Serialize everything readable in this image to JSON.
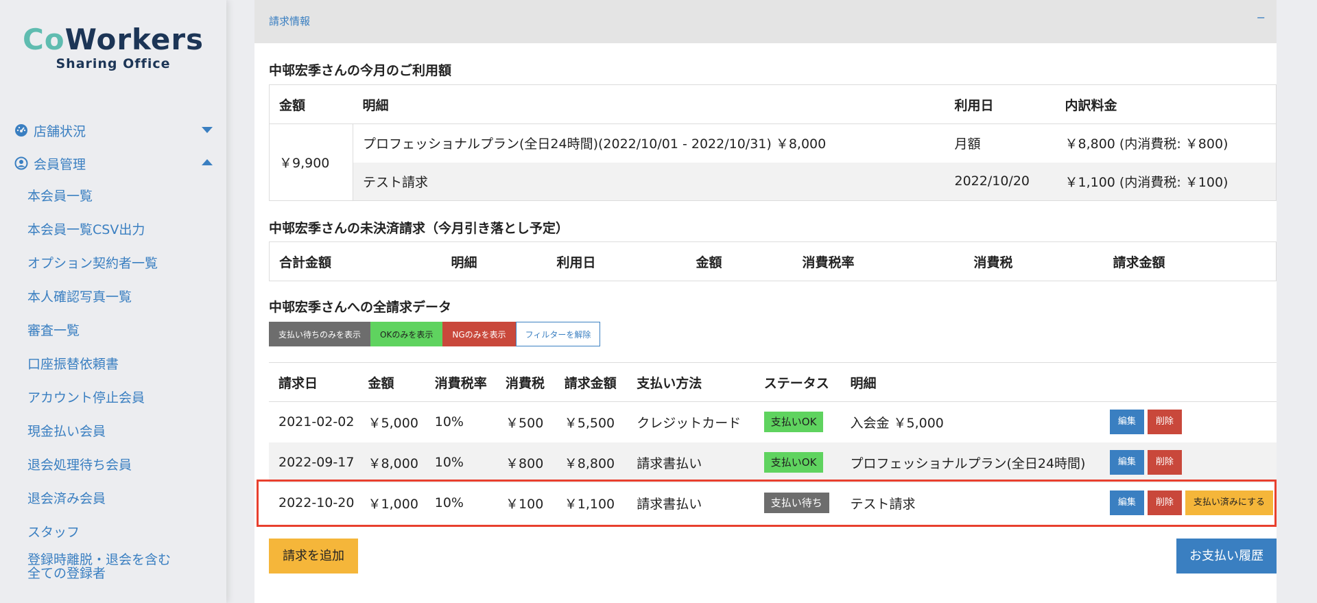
{
  "brand": {
    "logo_co": "Co",
    "logo_workers": "Workers",
    "logo_sub": "Sharing Office",
    "colors": {
      "primary": "#3a7fc1",
      "teal": "#5fbcb0",
      "navy": "#1c3556"
    }
  },
  "sidebar": {
    "groups": [
      {
        "label": "店舗状況",
        "icon": "dashboard-icon",
        "state": "collapsed"
      },
      {
        "label": "会員管理",
        "icon": "user-circle-icon",
        "state": "expanded"
      }
    ],
    "items": [
      {
        "label": "本会員一覧"
      },
      {
        "label": "本会員一覧CSV出力"
      },
      {
        "label": "オプション契約者一覧"
      },
      {
        "label": "本人確認写真一覧"
      },
      {
        "label": "審査一覧"
      },
      {
        "label": "口座振替依頼書"
      },
      {
        "label": "アカウント停止会員"
      },
      {
        "label": "現金払い会員"
      },
      {
        "label": "退会処理待ち会員"
      },
      {
        "label": "退会済み会員"
      },
      {
        "label": "スタッフ"
      },
      {
        "label_line1": "登録時離脱・退会を含む",
        "label_line2": "全ての登録者"
      }
    ]
  },
  "panel": {
    "title": "請求情報",
    "collapse_label": "−"
  },
  "usage": {
    "title": "中邨宏季さんの今月のご利用額",
    "headers": [
      "金額",
      "明細",
      "利用日",
      "内訳料金"
    ],
    "total": "￥9,900",
    "rows": [
      {
        "detail": "プロフェッショナルプラン(全日24時間)(2022/10/01 - 2022/10/31) ￥8,000",
        "date": "月額",
        "breakdown": "￥8,800 (内消費税: ￥800)"
      },
      {
        "detail": "テスト請求",
        "date": "2022/10/20",
        "breakdown": "￥1,100 (内消費税: ￥100)"
      }
    ]
  },
  "unsettled": {
    "title": "中邨宏季さんの未決済請求（今月引き落とし予定）",
    "headers": [
      "合計金額",
      "明細",
      "利用日",
      "金額",
      "消費税率",
      "消費税",
      "請求金額"
    ]
  },
  "all_billing": {
    "title": "中邨宏季さんへの全請求データ",
    "filters": {
      "wait_only": "支払い待ちのみを表示",
      "ok_only": "OKのみを表示",
      "ng_only": "NGのみを表示",
      "clear": "フィルターを解除"
    },
    "headers": [
      "請求日",
      "金額",
      "消費税率",
      "消費税",
      "請求金額",
      "支払い方法",
      "ステータス",
      "明細"
    ],
    "rows": [
      {
        "date": "2021-02-02",
        "amount": "￥5,000",
        "tax_rate": "10%",
        "tax": "￥500",
        "total": "￥5,500",
        "method": "クレジットカード",
        "status": "支払いOK",
        "detail": "入会金 ￥5,000"
      },
      {
        "date": "2022-09-17",
        "amount": "￥8,000",
        "tax_rate": "10%",
        "tax": "￥800",
        "total": "￥8,800",
        "method": "請求書払い",
        "status": "支払いOK",
        "detail": "プロフェッショナルプラン(全日24時間)"
      },
      {
        "date": "2022-10-20",
        "amount": "￥1,000",
        "tax_rate": "10%",
        "tax": "￥100",
        "total": "￥1,100",
        "method": "請求書払い",
        "status": "支払い待ち",
        "detail": "テスト請求"
      }
    ],
    "actions": {
      "edit": "編集",
      "delete": "削除",
      "mark_paid": "支払い済みにする"
    },
    "add_button": "請求を追加",
    "history_button": "お支払い履歴"
  }
}
